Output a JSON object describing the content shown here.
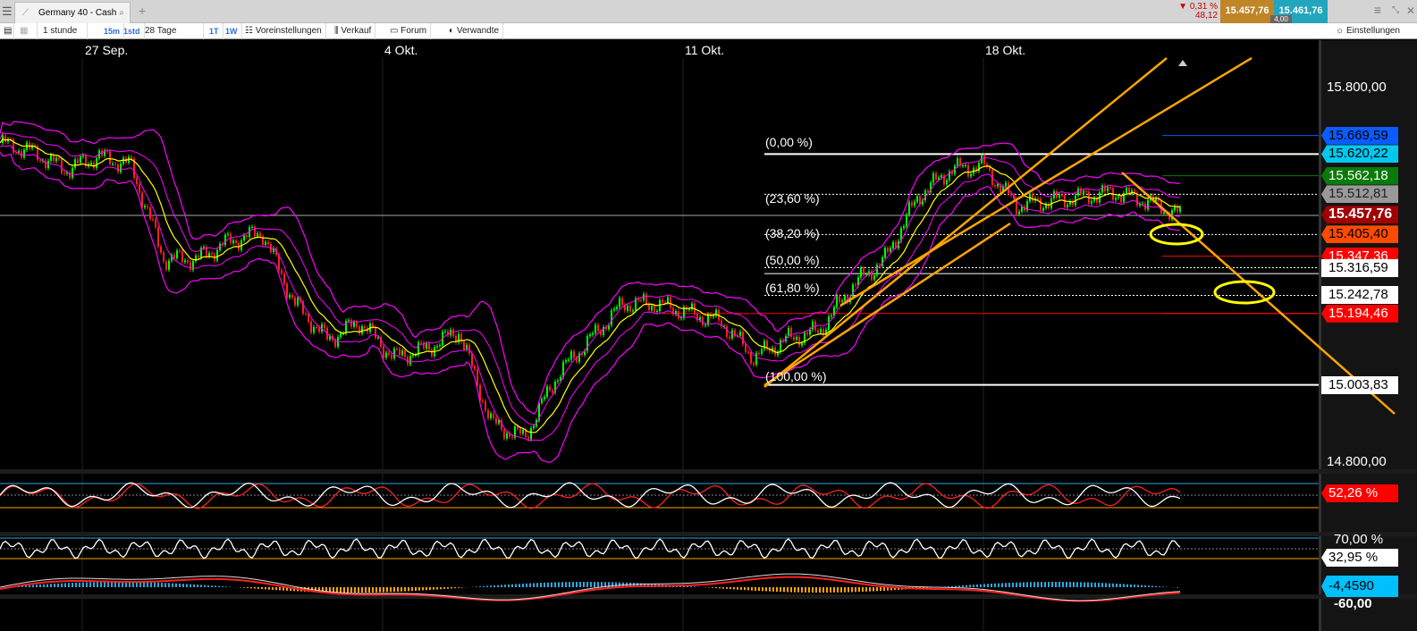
{
  "tabbar": {
    "tab_title": "Germany 40 - Cash",
    "add_tab": "+",
    "change_pct": "0,31 %",
    "change_abs": "48,12",
    "bid": "15.457,76",
    "ask": "15.461,76",
    "spread": "4,00"
  },
  "toolbar": {
    "interval": "1 stunde",
    "btn_15m": "15m",
    "btn_1std": "1std",
    "range": "28 Tage",
    "btn_1t": "1T",
    "btn_1w": "1W",
    "presets": "Voreinstellungen",
    "sell": "Verkauf",
    "forum": "Forum",
    "related": "Verwandte",
    "settings": "Einstellungen"
  },
  "x_labels": [
    "27 Sep.",
    "4 Okt.",
    "11 Okt.",
    "18 Okt."
  ],
  "price_axis": {
    "top": "15.800,00",
    "bottom": "14.800,00"
  },
  "fib_labels": [
    "(0,00 %)",
    "(23,60 %)",
    "(38,20 %)",
    "(50,00 %)",
    "(61,80 %)",
    "(100,00 %)"
  ],
  "price_tags": [
    {
      "value": "15.669,59",
      "price": 15669.59,
      "bg": "#0a5cff",
      "fg": "#000"
    },
    {
      "value": "15.620,22",
      "price": 15620.22,
      "bg": "#00c8f0",
      "fg": "#000"
    },
    {
      "value": "15.562,18",
      "price": 15562.18,
      "bg": "#0a7a0a",
      "fg": "#fff"
    },
    {
      "value": "15.512,81",
      "price": 15512.81,
      "bg": "#999999",
      "fg": "#222"
    },
    {
      "value": "15.457,76",
      "price": 15457.76,
      "bg": "#a00000",
      "fg": "#fff"
    },
    {
      "value": "15.405,40",
      "price": 15405.4,
      "bg": "#ff4a00",
      "fg": "#000"
    },
    {
      "value": "15.347,36",
      "price": 15347.36,
      "bg": "#ff0000",
      "fg": "#fff"
    },
    {
      "value": "15.316,59",
      "price": 15316.59,
      "bg": "#fff",
      "fg": "#000"
    },
    {
      "value": "15.242,78",
      "price": 15242.78,
      "bg": "#fff",
      "fg": "#000"
    },
    {
      "value": "15.194,46",
      "price": 15194.46,
      "bg": "#ff0000",
      "fg": "#fff"
    },
    {
      "value": "15.003,83",
      "price": 15003.83,
      "bg": "#fff",
      "fg": "#000"
    }
  ],
  "indicators": {
    "rsi_value": "52,26 %",
    "rsi2_value": "32,95 %",
    "rsi2_upper": "70,00 %",
    "macd_value": "-4,4590",
    "macd_lower": "-60,00"
  },
  "price_path": [
    15650,
    15626,
    15578,
    15614,
    15590,
    15340,
    15340,
    15387,
    15411,
    15220,
    15125,
    15172,
    15077,
    15100,
    15148,
    14900,
    14862,
    15030,
    15125,
    15220,
    15220,
    15196,
    15172,
    15077,
    15125,
    15148,
    15267,
    15340,
    15506,
    15578,
    15590,
    15483,
    15494,
    15506,
    15518,
    15494,
    15458
  ]
}
